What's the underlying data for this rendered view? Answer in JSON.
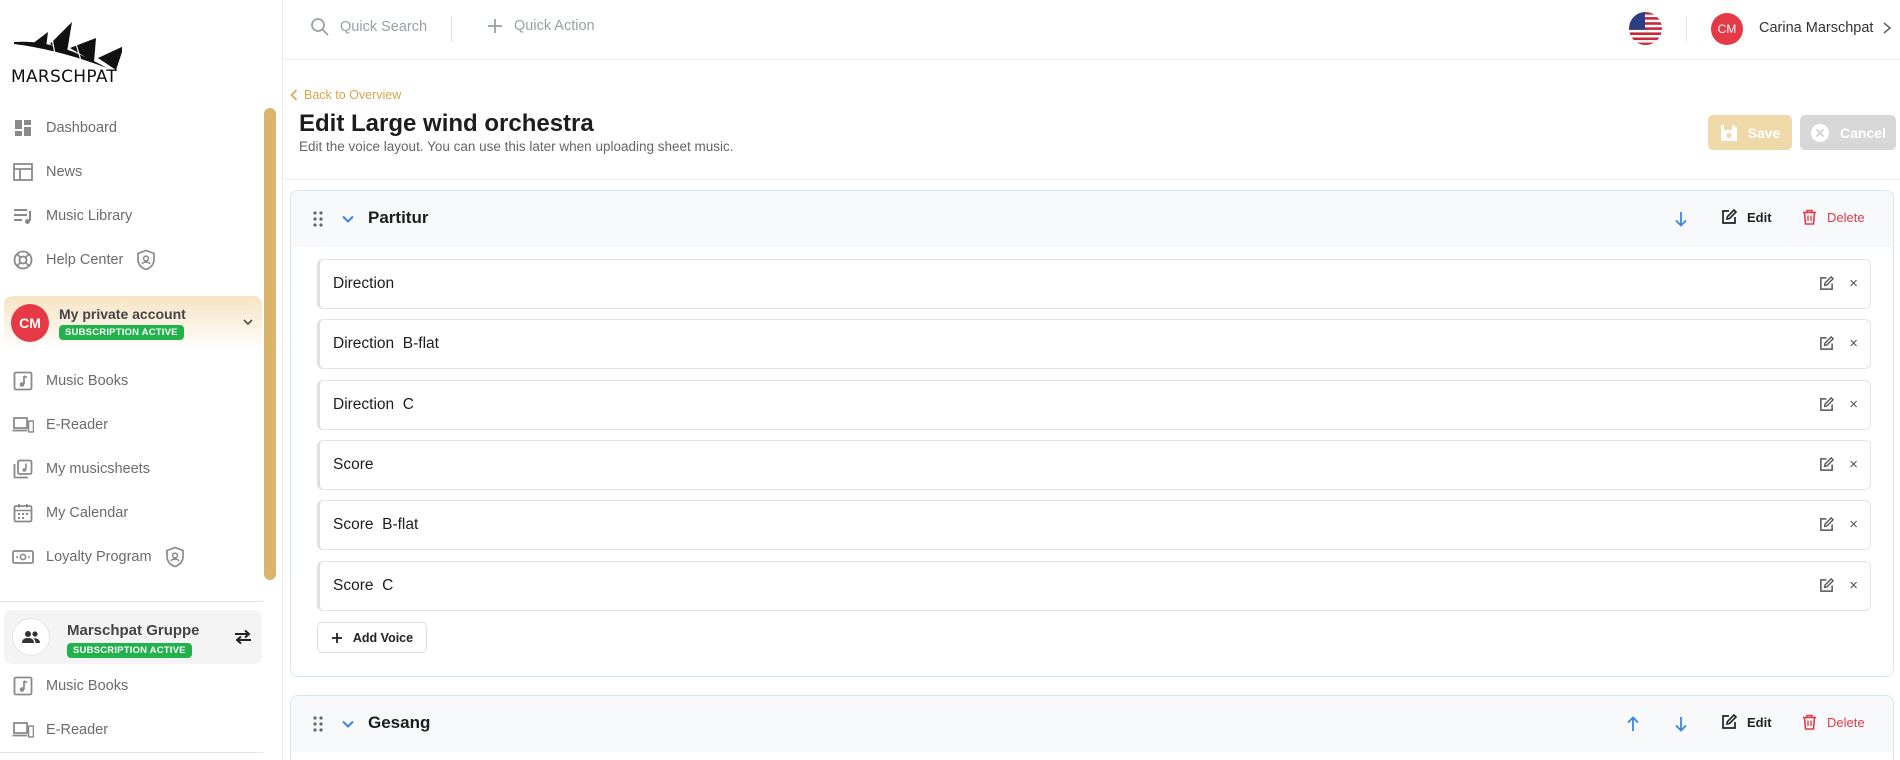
{
  "brand": {
    "name": "MARSCHPAT"
  },
  "sidebar": {
    "top_items": [
      {
        "label": "Dashboard",
        "icon": "dashboard-icon"
      },
      {
        "label": "News",
        "icon": "news-icon"
      },
      {
        "label": "Music Library",
        "icon": "music-library-icon"
      },
      {
        "label": "Help Center",
        "icon": "help-center-icon"
      }
    ],
    "account": {
      "initials": "CM",
      "name": "My private account",
      "badge": "SUBSCRIPTION ACTIVE",
      "items": [
        {
          "label": "Music Books",
          "icon": "music-book-icon"
        },
        {
          "label": "E-Reader",
          "icon": "e-reader-icon"
        },
        {
          "label": "My musicsheets",
          "icon": "musicsheets-icon"
        },
        {
          "label": "My Calendar",
          "icon": "calendar-icon"
        },
        {
          "label": "Loyalty Program",
          "icon": "loyalty-icon"
        }
      ]
    },
    "group": {
      "name": "Marschpat Gruppe",
      "badge": "SUBSCRIPTION ACTIVE",
      "items": [
        {
          "label": "Music Books",
          "icon": "music-book-icon"
        },
        {
          "label": "E-Reader",
          "icon": "e-reader-icon"
        }
      ]
    }
  },
  "topbar": {
    "quick_search": "Quick Search",
    "quick_action": "Quick Action",
    "user_initials": "CM",
    "user_name": "Carina Marschpat"
  },
  "header": {
    "back": "Back to Overview",
    "title": "Edit Large wind orchestra",
    "subtitle": "Edit the voice layout. You can use this later when uploading sheet music.",
    "save": "Save",
    "cancel": "Cancel"
  },
  "actions": {
    "edit": "Edit",
    "delete": "Delete",
    "add_voice": "Add Voice"
  },
  "sections": [
    {
      "title": "Partitur",
      "voices": [
        "Direction",
        "Direction  B-flat",
        "Direction  C",
        "Score",
        "Score  B-flat",
        "Score  C"
      ]
    },
    {
      "title": "Gesang",
      "voices": []
    }
  ],
  "colors": {
    "accent": "#d9a64f",
    "danger": "#e53945",
    "success": "#21b24b",
    "link_blue": "#3a86e0"
  }
}
